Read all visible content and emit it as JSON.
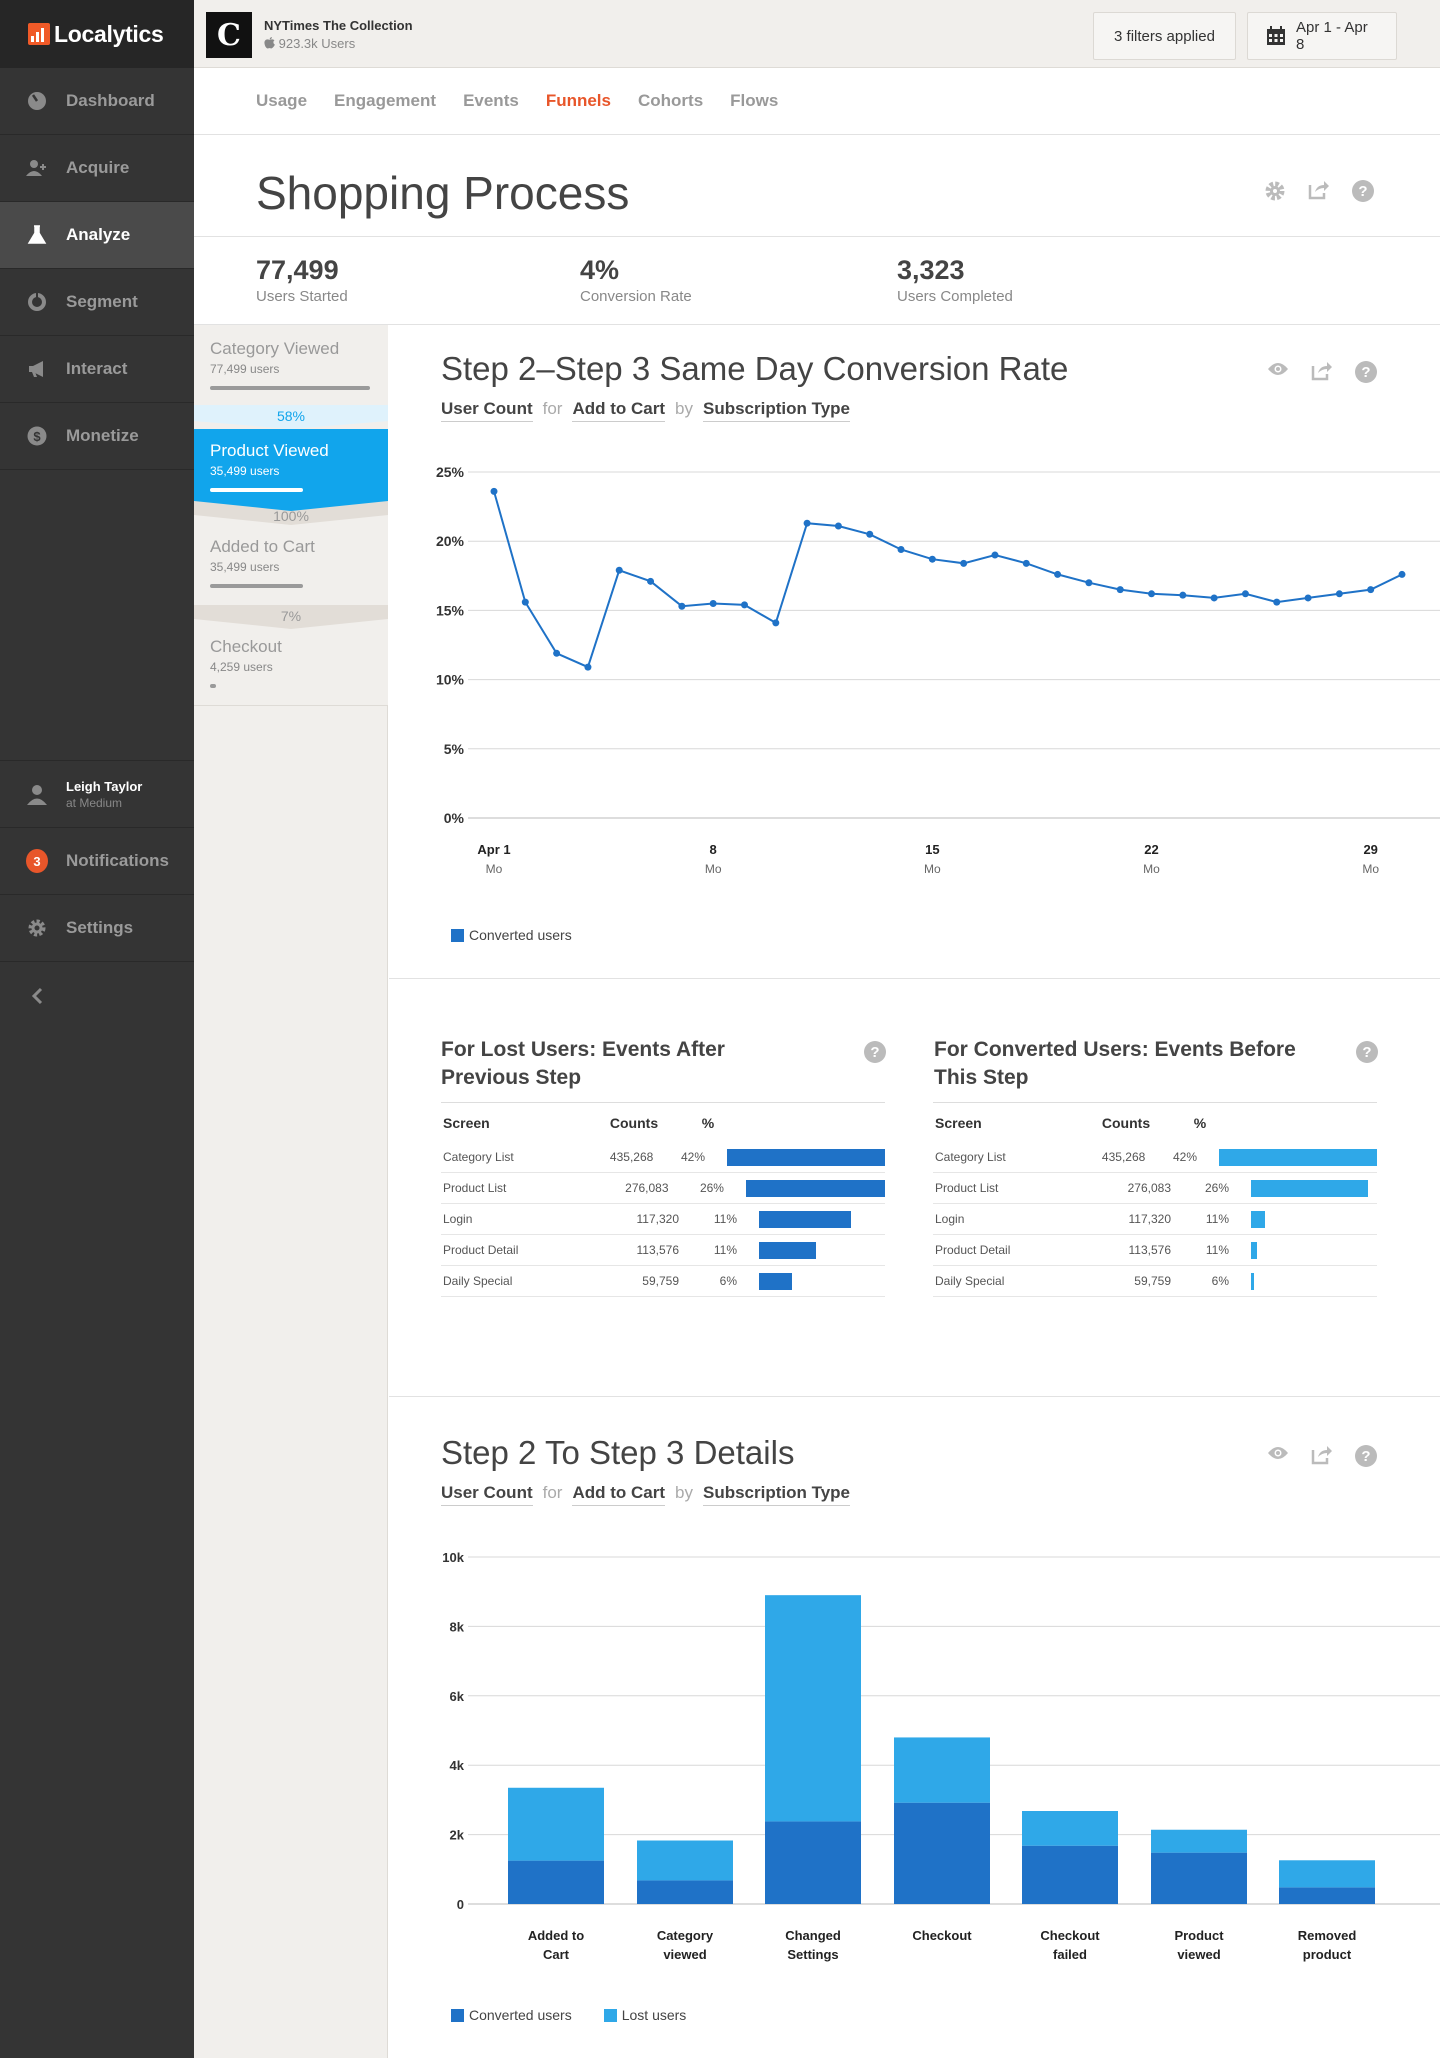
{
  "sidebar": {
    "logo": "Localytics",
    "items": [
      {
        "label": "Dashboard",
        "active": false
      },
      {
        "label": "Acquire",
        "active": false
      },
      {
        "label": "Analyze",
        "active": true
      },
      {
        "label": "Segment",
        "active": false
      },
      {
        "label": "Interact",
        "active": false
      },
      {
        "label": "Monetize",
        "active": false
      }
    ],
    "user": {
      "name": "Leigh Taylor",
      "org": "at Medium"
    },
    "notifications": {
      "label": "Notifications",
      "count": "3"
    },
    "settings": "Settings"
  },
  "topbar": {
    "app_name": "NYTimes The Collection",
    "app_users": "923.3k Users",
    "filters": "3 filters applied",
    "date_range": "Apr 1 - Apr 8"
  },
  "tabs": [
    "Usage",
    "Engagement",
    "Events",
    "Funnels",
    "Cohorts",
    "Flows"
  ],
  "active_tab": "Funnels",
  "page": {
    "title": "Shopping Process",
    "stats": [
      {
        "value": "77,499",
        "label": "Users Started"
      },
      {
        "value": "4%",
        "label": "Conversion Rate"
      },
      {
        "value": "3,323",
        "label": "Users Completed"
      }
    ]
  },
  "funnel": {
    "steps": [
      {
        "name": "Category Viewed",
        "users": "77,499 users",
        "fraction": 1.0
      },
      {
        "name": "Product Viewed",
        "users": "35,499 users",
        "fraction": 0.58
      },
      {
        "name": "Added to Cart",
        "users": "35,499 users",
        "fraction": 0.58
      },
      {
        "name": "Checkout",
        "users": "4,259 users",
        "fraction": 0.04
      }
    ],
    "conversions": [
      "58%",
      "100%",
      "7%"
    ]
  },
  "conversion_section": {
    "title": "Step 2–Step 3 Same Day Conversion Rate",
    "metric": "User Count",
    "for_word": "for",
    "event": "Add to Cart",
    "by_word": "by",
    "dimension": "Subscription Type"
  },
  "tables": {
    "lost": {
      "title_line1": "For Lost Users: Events After",
      "title_line2": "Previous Step",
      "headers": [
        "Screen",
        "Counts",
        "%"
      ],
      "rows": [
        {
          "screen": "Category List",
          "count": "435,268",
          "pct": "42%",
          "bar": 1.0
        },
        {
          "screen": "Product List",
          "count": "276,083",
          "pct": "26%",
          "bar": 0.88
        },
        {
          "screen": "Login",
          "count": "117,320",
          "pct": "11%",
          "bar": 0.58
        },
        {
          "screen": "Product Detail",
          "count": "113,576",
          "pct": "11%",
          "bar": 0.36
        },
        {
          "screen": "Daily Special",
          "count": "59,759",
          "pct": "6%",
          "bar": 0.21
        }
      ]
    },
    "converted": {
      "title_line1": "For Converted Users: Events Before",
      "title_line2": "This Step",
      "headers": [
        "Screen",
        "Counts",
        "%"
      ],
      "rows": [
        {
          "screen": "Category List",
          "count": "435,268",
          "pct": "42%",
          "bar": 1.0
        },
        {
          "screen": "Product List",
          "count": "276,083",
          "pct": "26%",
          "bar": 0.74
        },
        {
          "screen": "Login",
          "count": "117,320",
          "pct": "11%",
          "bar": 0.09
        },
        {
          "screen": "Product Detail",
          "count": "113,576",
          "pct": "11%",
          "bar": 0.04
        },
        {
          "screen": "Daily Special",
          "count": "59,759",
          "pct": "6%",
          "bar": 0.015
        }
      ]
    }
  },
  "details_section": {
    "title": "Step 2 To Step 3 Details",
    "metric": "User Count",
    "for_word": "for",
    "event": "Add to Cart",
    "by_word": "by",
    "dimension": "Subscription Type"
  },
  "colors": {
    "converted": "#1f72c7",
    "lost": "#2fa8e8",
    "accent": "#e8562a",
    "funnel_active": "#11a5ec"
  },
  "chart_data": [
    {
      "type": "line",
      "title": "Step 2–Step 3 Same Day Conversion Rate",
      "x": [
        "Apr 1",
        "Apr 2",
        "Apr 3",
        "Apr 4",
        "Apr 5",
        "Apr 6",
        "Apr 7",
        "Apr 8",
        "Apr 9",
        "Apr 10",
        "Apr 11",
        "Apr 12",
        "Apr 13",
        "Apr 14",
        "Apr 15",
        "Apr 16",
        "Apr 17",
        "Apr 18",
        "Apr 19",
        "Apr 20",
        "Apr 21",
        "Apr 22",
        "Apr 23",
        "Apr 24",
        "Apr 25",
        "Apr 26",
        "Apr 27",
        "Apr 28",
        "Apr 29",
        "Apr 30"
      ],
      "x_ticks": [
        {
          "label": "Apr 1",
          "sub": "Mo",
          "index": 0
        },
        {
          "label": "8",
          "sub": "Mo",
          "index": 7
        },
        {
          "label": "15",
          "sub": "Mo",
          "index": 14
        },
        {
          "label": "22",
          "sub": "Mo",
          "index": 21
        },
        {
          "label": "29",
          "sub": "Mo",
          "index": 28
        }
      ],
      "series": [
        {
          "name": "Converted users",
          "values": [
            23.6,
            15.6,
            11.9,
            10.9,
            17.9,
            17.1,
            15.3,
            15.5,
            15.4,
            14.1,
            21.3,
            21.1,
            20.5,
            19.4,
            18.7,
            18.4,
            19.0,
            18.4,
            17.6,
            17.0,
            16.5,
            16.2,
            16.1,
            15.9,
            16.2,
            15.6,
            15.9,
            16.2,
            16.5,
            17.6
          ]
        }
      ],
      "y_ticks": [
        "0%",
        "5%",
        "10%",
        "15%",
        "20%",
        "25%"
      ],
      "ylim": [
        0,
        25
      ],
      "grid": true,
      "legend": "bottom-left"
    },
    {
      "type": "bar",
      "stacked": true,
      "title": "Step 2 To Step 3 Details",
      "categories": [
        [
          "Added to",
          "Cart"
        ],
        [
          "Category",
          "viewed"
        ],
        [
          "Changed",
          "Settings"
        ],
        [
          "Checkout"
        ],
        [
          "Checkout",
          "failed"
        ],
        [
          "Product",
          "viewed"
        ],
        [
          "Removed",
          "product"
        ]
      ],
      "series": [
        {
          "name": "Converted users",
          "values": [
            1250,
            680,
            2380,
            2920,
            1680,
            1480,
            480
          ]
        },
        {
          "name": "Lost users",
          "values": [
            2100,
            1150,
            6520,
            1880,
            1000,
            660,
            780
          ]
        }
      ],
      "y_ticks": [
        "0",
        "2k",
        "4k",
        "6k",
        "8k",
        "10k"
      ],
      "ylim": [
        0,
        10000
      ],
      "grid": true,
      "legend": "bottom-left"
    }
  ]
}
